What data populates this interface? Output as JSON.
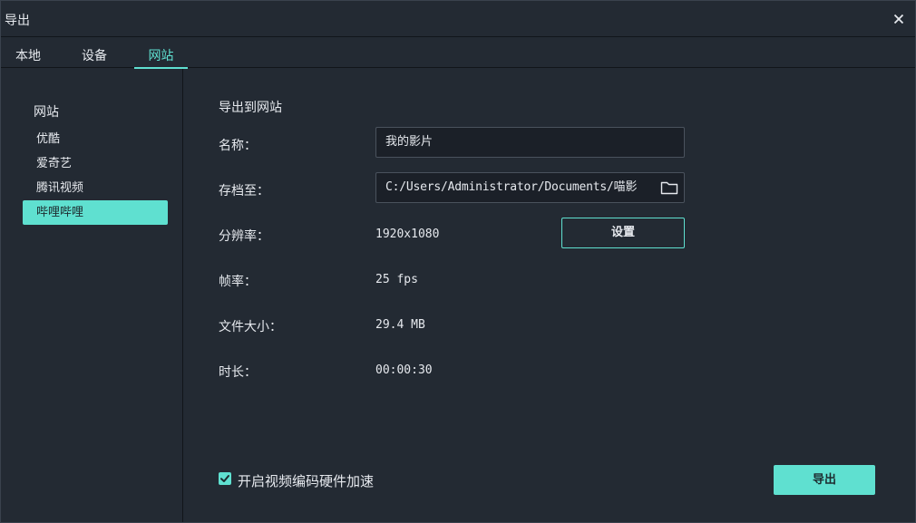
{
  "window": {
    "title": "导出",
    "close_icon": "close-icon"
  },
  "tabs": [
    {
      "label": "本地"
    },
    {
      "label": "设备"
    },
    {
      "label": "网站",
      "active": true
    }
  ],
  "sidebar": {
    "heading": "网站",
    "items": [
      {
        "label": "优酷"
      },
      {
        "label": "爱奇艺"
      },
      {
        "label": "腾讯视频"
      },
      {
        "label": "哔哩哔哩",
        "selected": true
      }
    ]
  },
  "main": {
    "heading": "导出到网站",
    "name_label": "名称：",
    "name_value": "我的影片",
    "path_label": "存档至：",
    "path_value": "C:/Users/Administrator/Documents/喵影",
    "folder_icon": "folder-icon",
    "resolution_label": "分辨率：",
    "resolution_value": "1920x1080",
    "settings_label": "设置",
    "framerate_label": "帧率：",
    "framerate_value": "25 fps",
    "filesize_label": "文件大小：",
    "filesize_value": "29.4 MB",
    "duration_label": "时长：",
    "duration_value": "00:00:30"
  },
  "footer": {
    "hw_accel_checked": true,
    "hw_accel_label": "开启视频编码硬件加速",
    "export_label": "导出"
  },
  "colors": {
    "accent": "#5fe0d0",
    "background": "#232a33",
    "input_bg": "#1b2028"
  }
}
